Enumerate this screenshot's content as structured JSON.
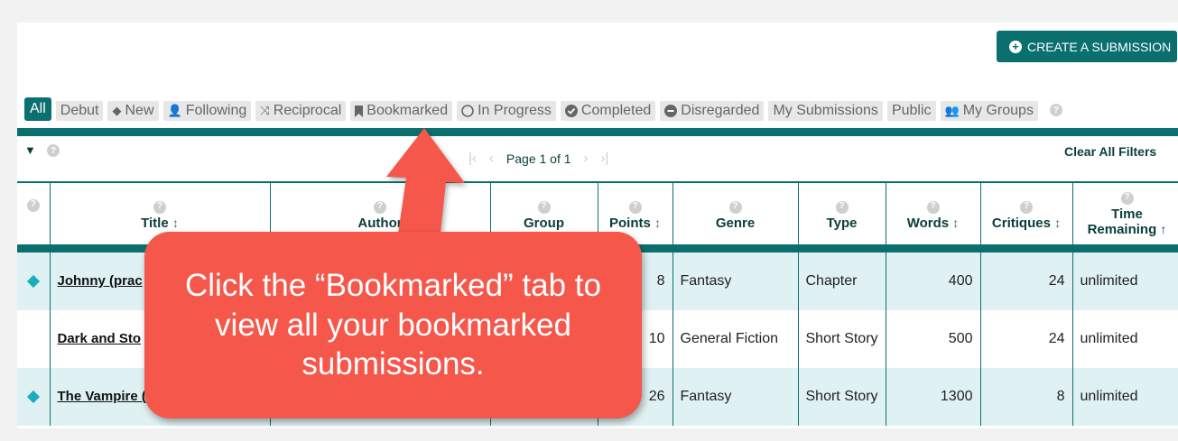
{
  "header": {
    "create_button": "CREATE A SUBMISSION"
  },
  "tabs": [
    {
      "label": "All",
      "icon": "",
      "active": true
    },
    {
      "label": "Debut",
      "icon": ""
    },
    {
      "label": "New",
      "icon": "diamond-icon"
    },
    {
      "label": "Following",
      "icon": "person-icon"
    },
    {
      "label": "Reciprocal",
      "icon": "shuffle-icon"
    },
    {
      "label": "Bookmarked",
      "icon": "bookmark-icon"
    },
    {
      "label": "In Progress",
      "icon": "circle-icon"
    },
    {
      "label": "Completed",
      "icon": "check-circle-icon"
    },
    {
      "label": "Disregarded",
      "icon": "minus-circle-icon"
    },
    {
      "label": "My Submissions",
      "icon": ""
    },
    {
      "label": "Public",
      "icon": ""
    },
    {
      "label": "My Groups",
      "icon": "group-icon"
    }
  ],
  "pager": {
    "label": "Page 1 of 1"
  },
  "filters": {
    "clear_all": "Clear All Filters"
  },
  "table": {
    "columns": [
      "Title",
      "Author",
      "Group",
      "Points",
      "Genre",
      "Type",
      "Words",
      "Critiques",
      "Time",
      "Remaining"
    ],
    "rows": [
      {
        "new": true,
        "title": "Johnny (prac",
        "points": "8",
        "genre": "Fantasy",
        "type": "Chapter",
        "words": "400",
        "critiques": "24",
        "time": "unlimited"
      },
      {
        "new": false,
        "title": "Dark and Sto",
        "points": "10",
        "genre": "General Fiction",
        "type": "Short Story",
        "words": "500",
        "critiques": "24",
        "time": "unlimited"
      },
      {
        "new": true,
        "title": "The Vampire (",
        "points": "26",
        "genre": "Fantasy",
        "type": "Short Story",
        "words": "1300",
        "critiques": "8",
        "time": "unlimited"
      }
    ]
  },
  "callout": {
    "text": "Click the “Bookmarked” tab to view all your bookmarked submissions."
  },
  "colors": {
    "accent": "#0b6f70",
    "row_highlight": "#e0f1f3",
    "callout": "#f5574b",
    "diamond": "#1aaebc"
  }
}
